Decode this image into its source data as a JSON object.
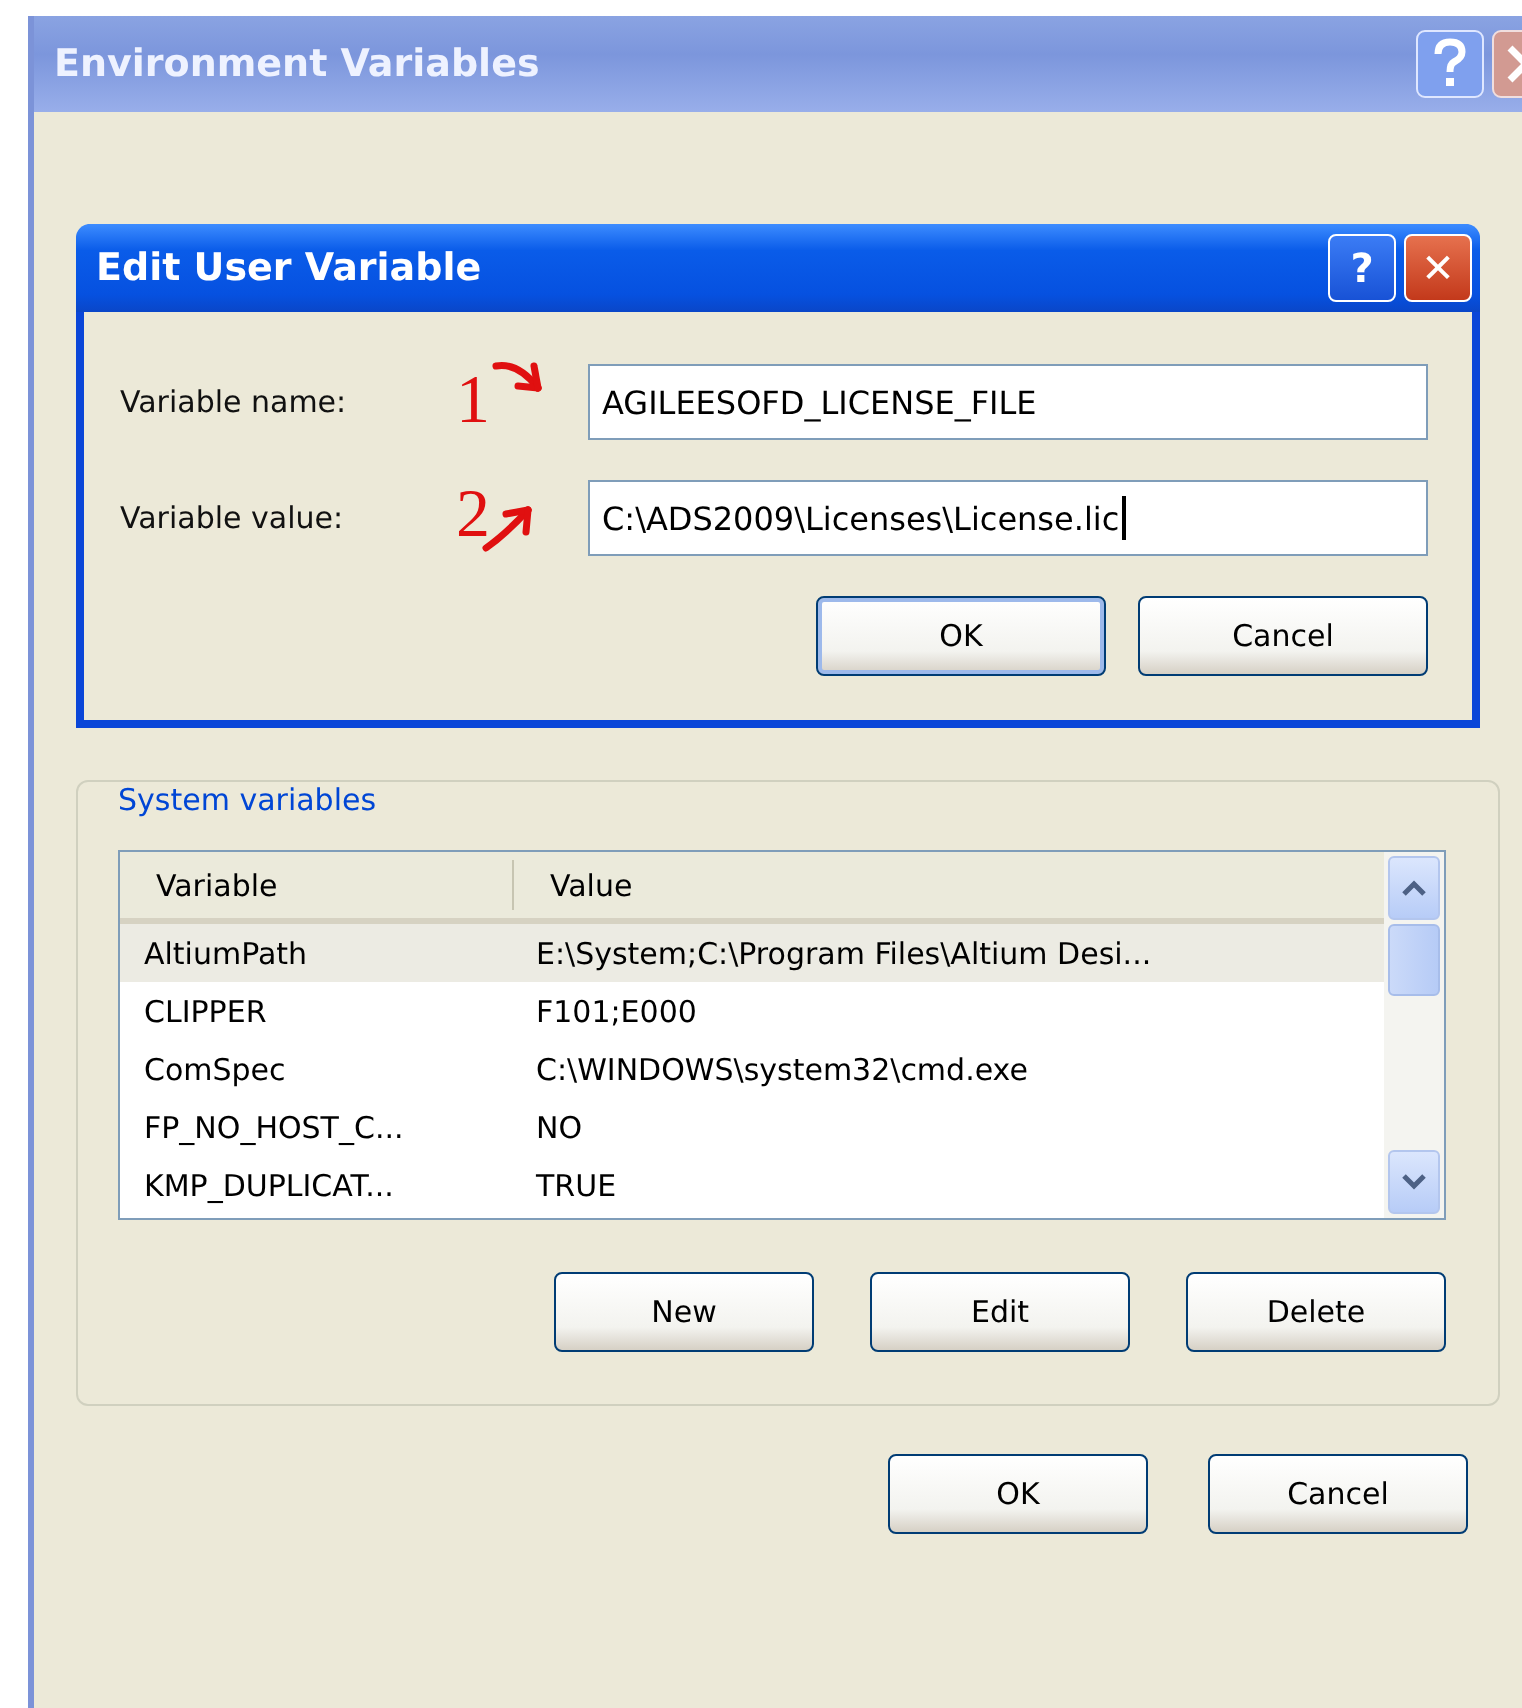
{
  "window": {
    "title": "Environment Variables"
  },
  "dialog": {
    "title": "Edit User Variable",
    "title_buttons": [
      "?",
      "✕"
    ],
    "fields": [
      {
        "label": "Variable name:",
        "value": "AGILEESOFD_LICENSE_FILE",
        "annotation": "1",
        "focused": false
      },
      {
        "label": "Variable value:",
        "value": "C:\\ADS2009\\Licenses\\License.lic",
        "annotation": "2",
        "focused": true
      }
    ],
    "buttons": [
      {
        "label": "OK",
        "default": true
      },
      {
        "label": "Cancel",
        "default": false
      }
    ]
  },
  "system_variables": {
    "title": "System variables",
    "columns": [
      "Variable",
      "Value"
    ],
    "rows": [
      {
        "variable": "AltiumPath",
        "value": "E:\\System;C:\\Program Files\\Altium Desi...",
        "selected": true
      },
      {
        "variable": "CLIPPER",
        "value": "F101;E000",
        "selected": false
      },
      {
        "variable": "ComSpec",
        "value": "C:\\WINDOWS\\system32\\cmd.exe",
        "selected": false
      },
      {
        "variable": "FP_NO_HOST_C...",
        "value": "NO",
        "selected": false
      },
      {
        "variable": "KMP_DUPLICAT...",
        "value": "TRUE",
        "selected": false
      }
    ],
    "buttons": [
      "New",
      "Edit",
      "Delete"
    ]
  },
  "buttons": [
    {
      "label": "OK",
      "default": false
    },
    {
      "label": "Cancel",
      "default": false
    }
  ]
}
